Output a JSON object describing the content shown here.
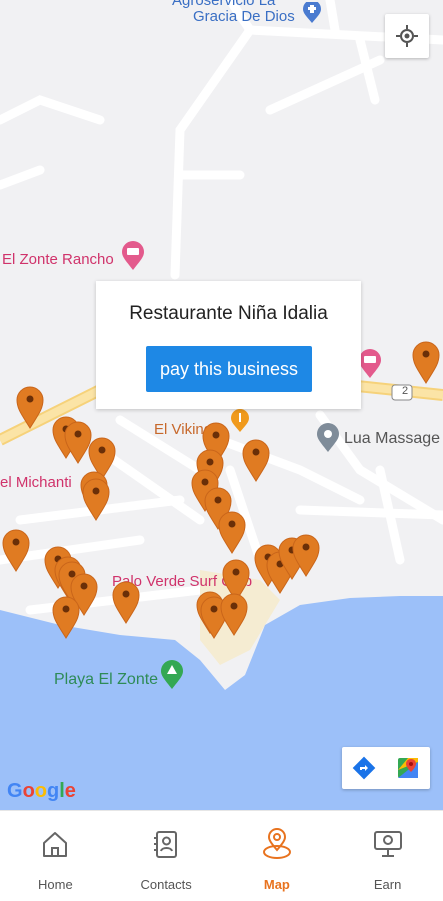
{
  "map": {
    "labels": {
      "top_church": "Gracia De Dios",
      "top_church_partial": "Agroservicio La",
      "rancho": "El Zonte Rancho",
      "michanti": "el Michanti",
      "vikingo": "El Vikingo",
      "lua": "Lua Massage",
      "palo_verde": "Palo Verde Surf Club",
      "playa": "Playa El Zonte",
      "route": "2"
    },
    "google_logo": "Google",
    "pin_color": "#e07b22",
    "water_color": "#9cc0f9"
  },
  "popup": {
    "business_name": "Restaurante Niña Idalia",
    "pay_button": "pay this business"
  },
  "controls": {
    "my_location_icon": "crosshair-icon",
    "directions_icon": "directions-icon",
    "google_maps_icon": "google-maps-icon"
  },
  "bottom_nav": {
    "tabs": [
      {
        "label": "Home",
        "icon": "home-icon",
        "active": false
      },
      {
        "label": "Contacts",
        "icon": "contacts-icon",
        "active": false
      },
      {
        "label": "Map",
        "icon": "map-pin-icon",
        "active": true
      },
      {
        "label": "Earn",
        "icon": "earn-icon",
        "active": false
      }
    ]
  }
}
